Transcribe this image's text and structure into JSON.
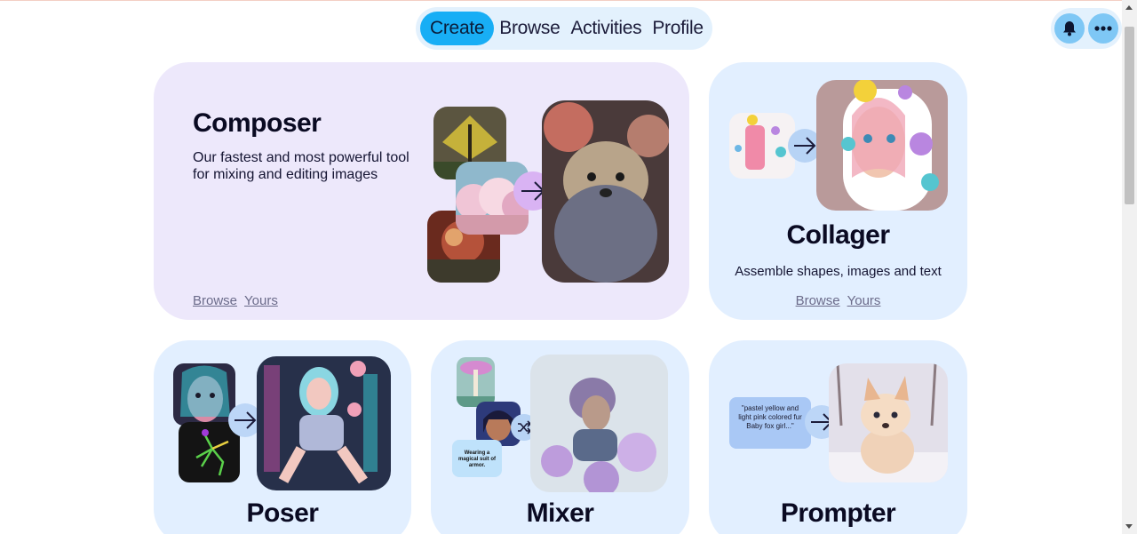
{
  "nav": {
    "items": [
      {
        "label": "Create",
        "active": true
      },
      {
        "label": "Browse",
        "active": false
      },
      {
        "label": "Activities",
        "active": false
      },
      {
        "label": "Profile",
        "active": false
      }
    ]
  },
  "top_icons": [
    "bell-icon",
    "more-icon"
  ],
  "colors": {
    "accent": "#18aef5",
    "nav_bg": "#e3f1fd",
    "composer_card": "#ede8fb",
    "tool_card": "#e2efff",
    "icon_button": "#7ec7f5"
  },
  "composer": {
    "title": "Composer",
    "description": "Our fastest and most powerful tool for mixing and editing images",
    "browse": "Browse",
    "yours": "Yours"
  },
  "collager": {
    "title": "Collager",
    "description": "Assemble shapes, images and text",
    "browse": "Browse",
    "yours": "Yours"
  },
  "poser": {
    "title": "Poser"
  },
  "mixer": {
    "title": "Mixer",
    "chip_text": "Wearing a magical suit of armor."
  },
  "prompter": {
    "title": "Prompter",
    "prompt_text": "\"pastel yellow and light pink colored fur Baby fox girl...\""
  }
}
